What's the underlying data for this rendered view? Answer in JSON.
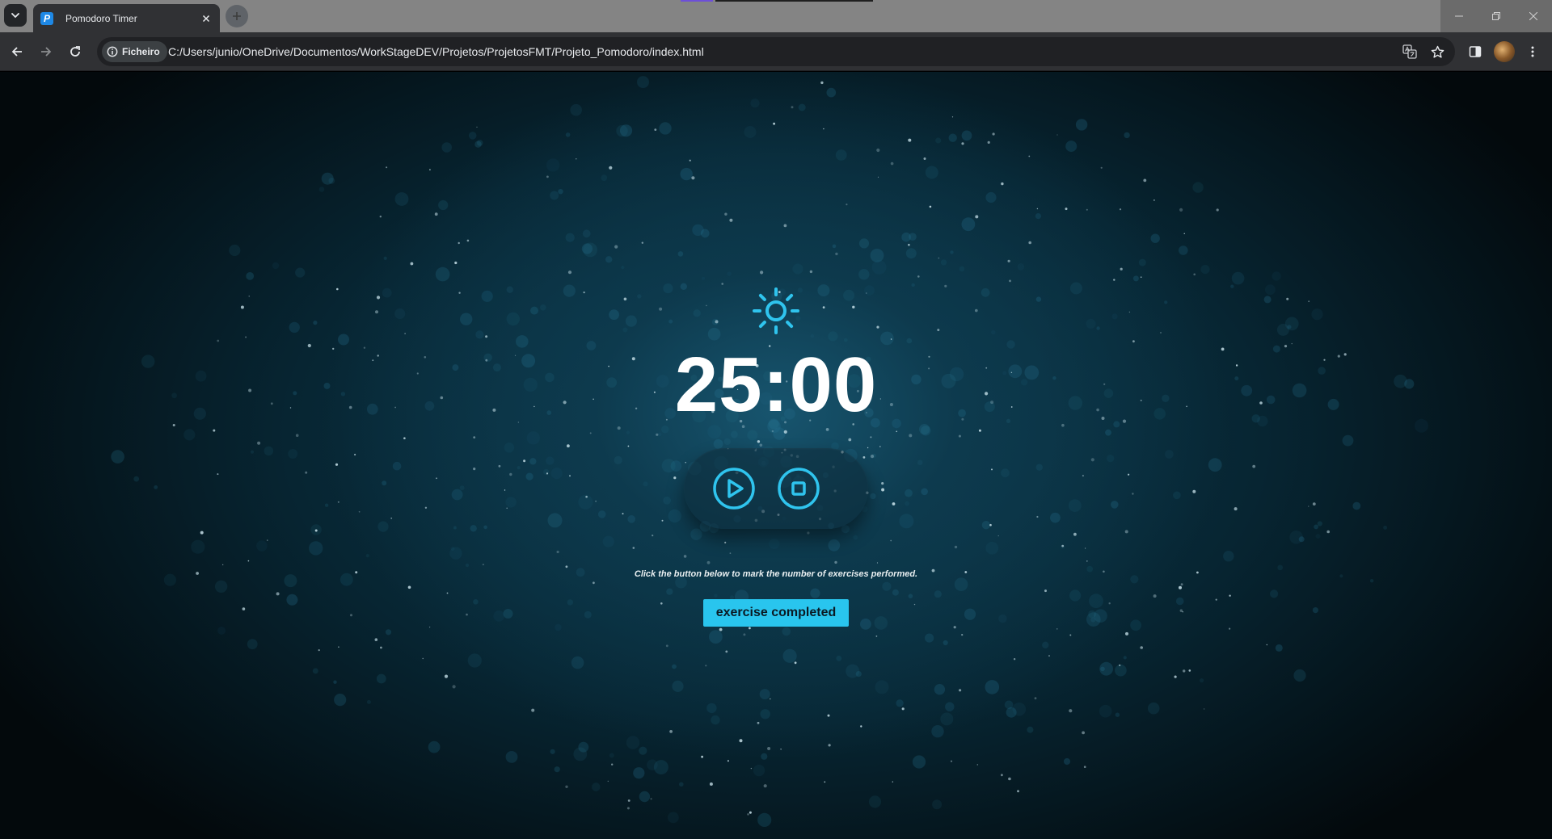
{
  "browser": {
    "tab": {
      "title": "Pomodoro Timer",
      "favicon": "P"
    },
    "address_bar": {
      "site_chip_label": "Ficheiro",
      "url": "C:/Users/junio/OneDrive/Documentos/WorkStageDEV/Projetos/ProjetosFMT/Projeto_Pomodoro/index.html"
    },
    "icons": [
      "tab-search-icon",
      "close-icon",
      "plus-icon",
      "minimize-icon",
      "restore-icon",
      "window-close-icon",
      "back-arrow-icon",
      "forward-arrow-icon",
      "reload-icon",
      "info-icon",
      "translate-icon",
      "star-icon",
      "side-panel-icon",
      "more-vert-icon"
    ]
  },
  "app": {
    "mode_icon": "sun-icon",
    "timer": "25:00",
    "controls": [
      "play-icon",
      "stop-icon"
    ],
    "hint": "Click the button below to mark the number of exercises performed.",
    "exercise_button": "exercise completed"
  },
  "colors": {
    "accent": "#2fc4ee",
    "button_bg": "#29c5ee",
    "page_bg_center": "#0c3b4f",
    "tab_bg": "#303134"
  }
}
